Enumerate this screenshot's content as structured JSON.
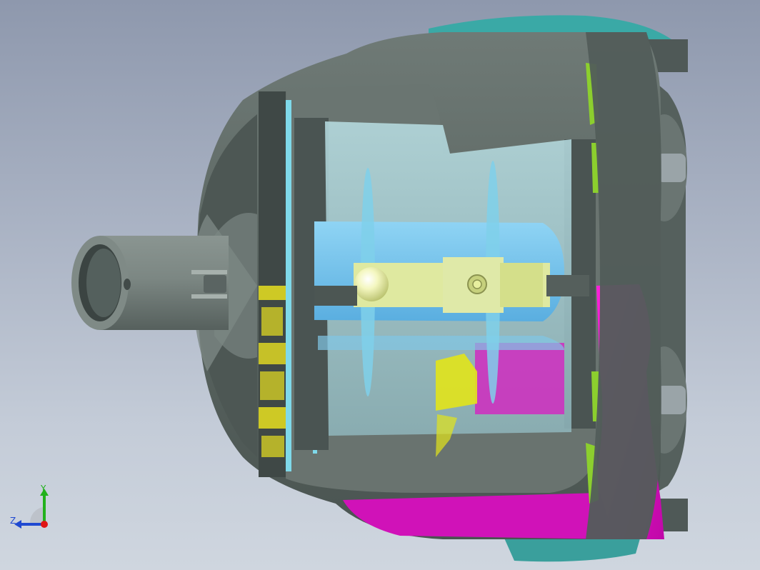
{
  "viewport": {
    "background_top": "#8e98ad",
    "background_bottom": "#cfd6df"
  },
  "model": {
    "colors": {
      "housing": "#5f6a66",
      "housing_dark": "#444d4a",
      "housing_light": "#76817d",
      "teal_part": "#3aa9a6",
      "magenta_part": "#e010c8",
      "yellow_part": "#e8e020",
      "green_part": "#8ccf2e",
      "cyan_glass": "#7fd9ea",
      "blue_shaft": "#66bde8",
      "yellow_link": "#e6f0a0"
    }
  },
  "triad": {
    "y_label": "Y",
    "z_label": "Z",
    "y_color": "#22b11c",
    "z_color": "#1f49d1",
    "x_color": "#e01515"
  }
}
